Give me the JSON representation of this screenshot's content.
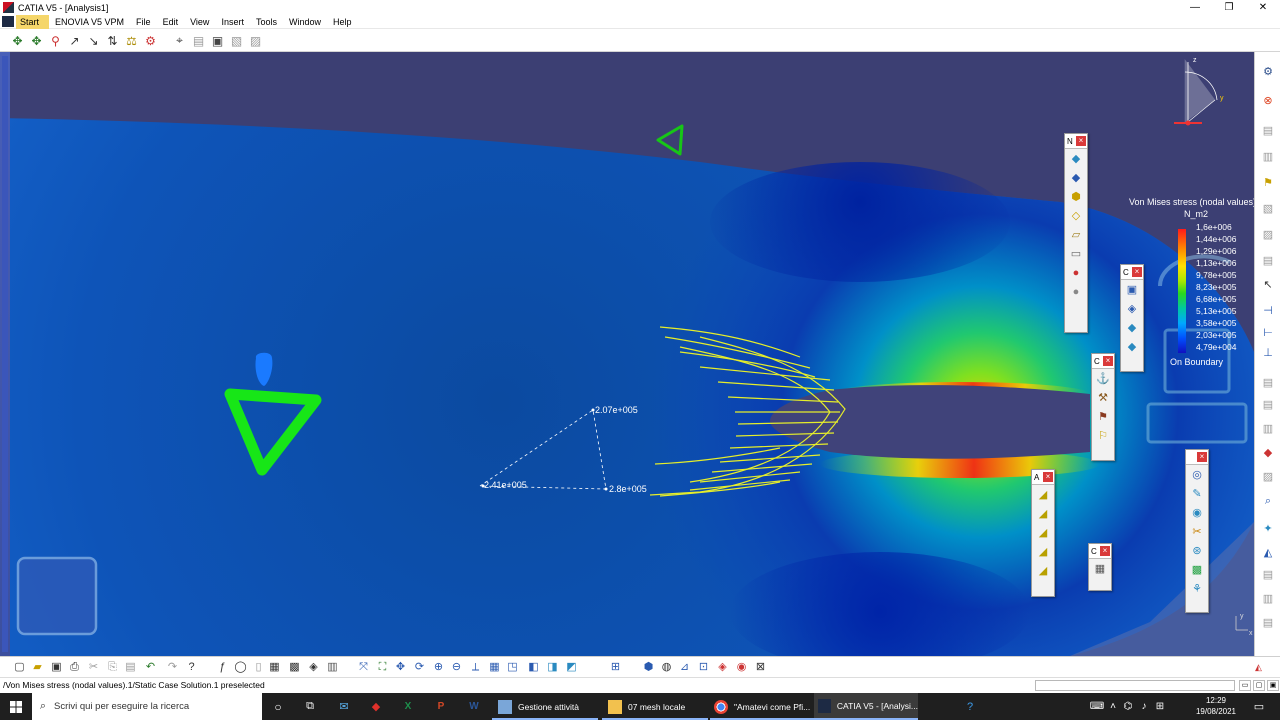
{
  "window": {
    "title": "CATIA V5 - [Analysis1]",
    "controls": [
      "—",
      "❐",
      "✕"
    ]
  },
  "menu": {
    "items": [
      "Start",
      "ENOVIA V5 VPM",
      "File",
      "Edit",
      "View",
      "Insert",
      "Tools",
      "Window",
      "Help"
    ]
  },
  "annotations": {
    "a1": "2.07e+005",
    "a2": "2.41e+005",
    "a3": "2.8e+005"
  },
  "legend": {
    "title": "Von Mises stress (nodal values)",
    "unit": "N_m2",
    "ticks": [
      "1,6e+006",
      "1,44e+006",
      "1,29e+006",
      "1,13e+006",
      "9,78e+005",
      "8,23e+005",
      "6,68e+005",
      "5,13e+005",
      "3,58e+005",
      "2,03e+005",
      "4,79e+004"
    ],
    "footer": "On Boundary",
    "colors": [
      "#ff1a1a",
      "#ff8a00",
      "#ffe000",
      "#28d820",
      "#00a8ff",
      "#1010c0"
    ]
  },
  "floatbars": {
    "b1": "N",
    "b2": "C",
    "b3": "C",
    "b4": "A",
    "b5": "C"
  },
  "compass": {
    "x_label": "y",
    "z_label": "z"
  },
  "corner_axis": {
    "x": "x",
    "y": "y"
  },
  "status": {
    "text": "/Von Mises stress (nodal values).1/Static Case Solution.1 preselected",
    "input_value": ""
  },
  "taskbar": {
    "search_placeholder": "Scrivi qui per eseguire la ricerca",
    "apps": [
      {
        "label": "Gestione attività"
      },
      {
        "label": "07 mesh locale"
      },
      {
        "label": "\"Amatevi come Pfi..."
      },
      {
        "label": "CATIA V5 - [Analysi..."
      }
    ],
    "time": "12:29",
    "date": "19/08/2021"
  },
  "theme": {
    "accent": "#8ab4f8",
    "viewport_bg": "#3c3f73",
    "arrow_color": "#e6ee2a",
    "marker_color": "#17e617"
  }
}
